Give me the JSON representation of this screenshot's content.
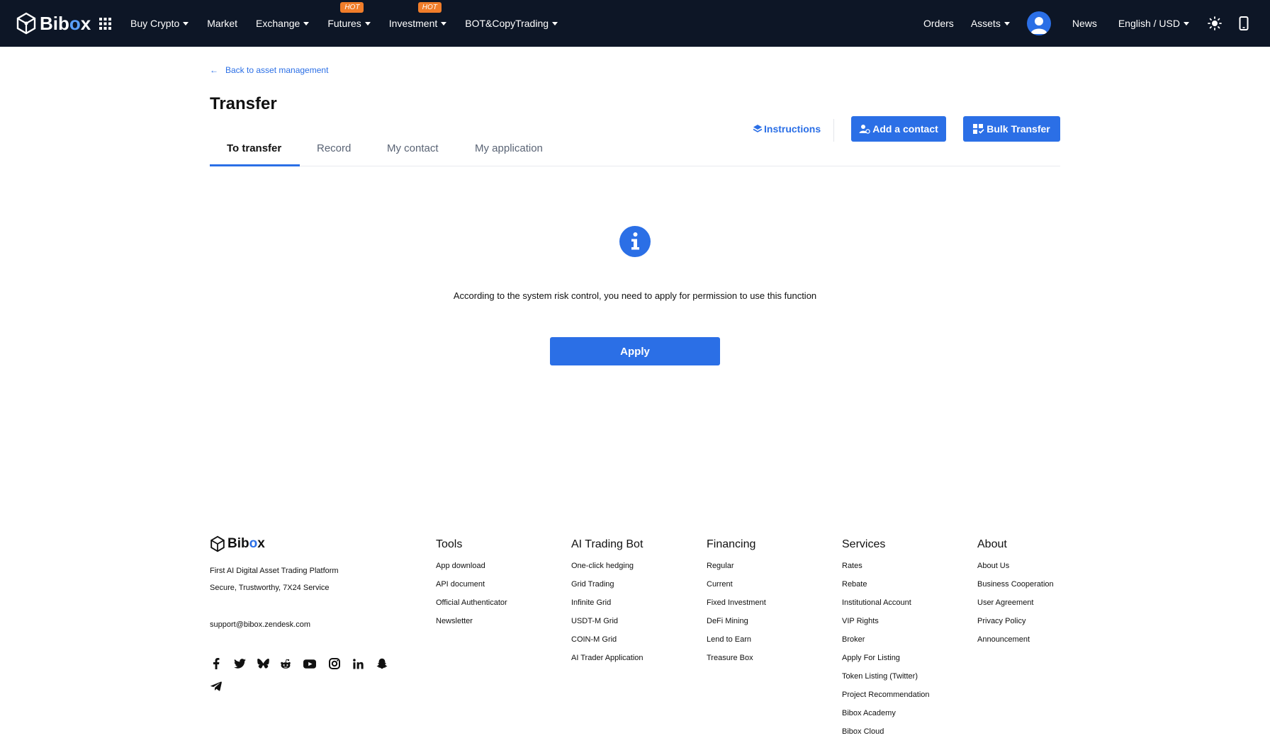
{
  "header": {
    "logo_text_main": "Bib",
    "logo_text_dot": "o",
    "logo_text_end": "x",
    "nav": [
      {
        "label": "Buy Crypto",
        "caret": true
      },
      {
        "label": "Market",
        "caret": false
      },
      {
        "label": "Exchange",
        "caret": true
      },
      {
        "label": "Futures",
        "caret": true,
        "badge": "HOT"
      },
      {
        "label": "Investment",
        "caret": true,
        "badge": "HOT"
      },
      {
        "label": "BOT&CopyTrading",
        "caret": true
      }
    ],
    "orders_label": "Orders",
    "assets_label": "Assets",
    "news_label": "News",
    "language_label": "English / USD",
    "accent_color": "#2b6fe6",
    "nav_bg": "#0d1626",
    "hot_color": "#f07d2a"
  },
  "page": {
    "back_label": "Back to asset management",
    "title": "Transfer",
    "tabs": [
      {
        "label": "To transfer",
        "active": true
      },
      {
        "label": "Record",
        "active": false
      },
      {
        "label": "My contact",
        "active": false
      },
      {
        "label": "My application",
        "active": false
      }
    ],
    "instructions_label": "Instructions",
    "add_contact_label": "Add a contact",
    "bulk_transfer_label": "Bulk Transfer",
    "message": "According to the system risk control, you need to apply for permission to use this function",
    "apply_label": "Apply"
  },
  "footer": {
    "logo_text_main": "Bib",
    "logo_text_dot": "o",
    "logo_text_end": "x",
    "tagline_1": "First AI Digital Asset Trading Platform",
    "tagline_2": "Secure, Trustworthy, 7X24 Service",
    "email": "support@bibox.zendesk.com",
    "socials": [
      "facebook-icon",
      "twitter-icon",
      "bluesky-icon",
      "reddit-icon",
      "youtube-icon",
      "instagram-icon",
      "linkedin-icon",
      "snapchat-icon",
      "telegram-icon"
    ],
    "columns": [
      {
        "title": "Tools",
        "links": [
          "App download",
          "API document",
          "Official Authenticator",
          "Newsletter"
        ]
      },
      {
        "title": "AI Trading Bot",
        "links": [
          "One-click hedging",
          "Grid Trading",
          "Infinite Grid",
          "USDT-M Grid",
          "COIN-M Grid",
          "AI Trader Application"
        ]
      },
      {
        "title": "Financing",
        "links": [
          "Regular",
          "Current",
          "Fixed Investment",
          "DeFi Mining",
          "Lend to Earn",
          "Treasure Box"
        ]
      },
      {
        "title": "Services",
        "links": [
          "Rates",
          "Rebate",
          "Institutional Account",
          "VIP Rights",
          "Broker",
          "Apply For Listing",
          "Token Listing (Twitter)",
          "Project Recommendation",
          "Bibox Academy",
          "Bibox Cloud"
        ]
      },
      {
        "title": "About",
        "links": [
          "About Us",
          "Business Cooperation",
          "User Agreement",
          "Privacy Policy",
          "Announcement"
        ]
      }
    ]
  }
}
